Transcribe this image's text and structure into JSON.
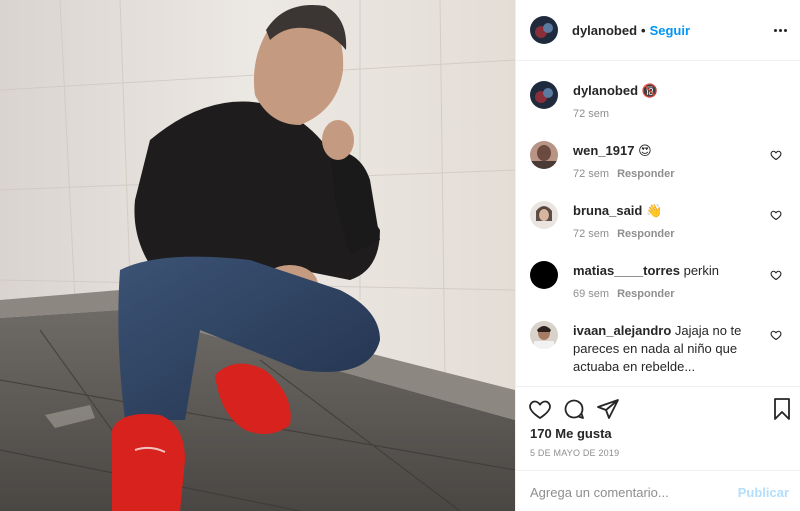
{
  "post": {
    "author": "dylanobed",
    "follow_label": "Seguir",
    "header_separator": "•",
    "more_icon": "more-horizontal-icon"
  },
  "caption": {
    "username": "dylanobed",
    "emoji": "🔞",
    "time": "72 sem"
  },
  "comments": [
    {
      "username": "wen_1917",
      "text": "😍",
      "time": "72 sem",
      "reply": "Responder"
    },
    {
      "username": "bruna_said",
      "text": "👋",
      "time": "72 sem",
      "reply": "Responder"
    },
    {
      "username": "matias____torres",
      "text": "perkin",
      "time": "69 sem",
      "reply": "Responder"
    },
    {
      "username": "ivaan_alejandro",
      "text": "Jajaja no te pareces en nada al niño que actuaba en rebelde...",
      "time": "",
      "reply": ""
    }
  ],
  "actions": {
    "like_icon": "heart-icon",
    "comment_icon": "comment-icon",
    "share_icon": "share-icon",
    "save_icon": "bookmark-icon",
    "likes_label": "170 Me gusta",
    "date": "5 DE MAYO DE 2019"
  },
  "add_comment": {
    "placeholder": "Agrega un comentario...",
    "post_label": "Publicar"
  },
  "colors": {
    "link_blue": "#0095f6",
    "publish_disabled": "#b2dffc",
    "muted_text": "#8e8e8e",
    "text": "#262626"
  }
}
